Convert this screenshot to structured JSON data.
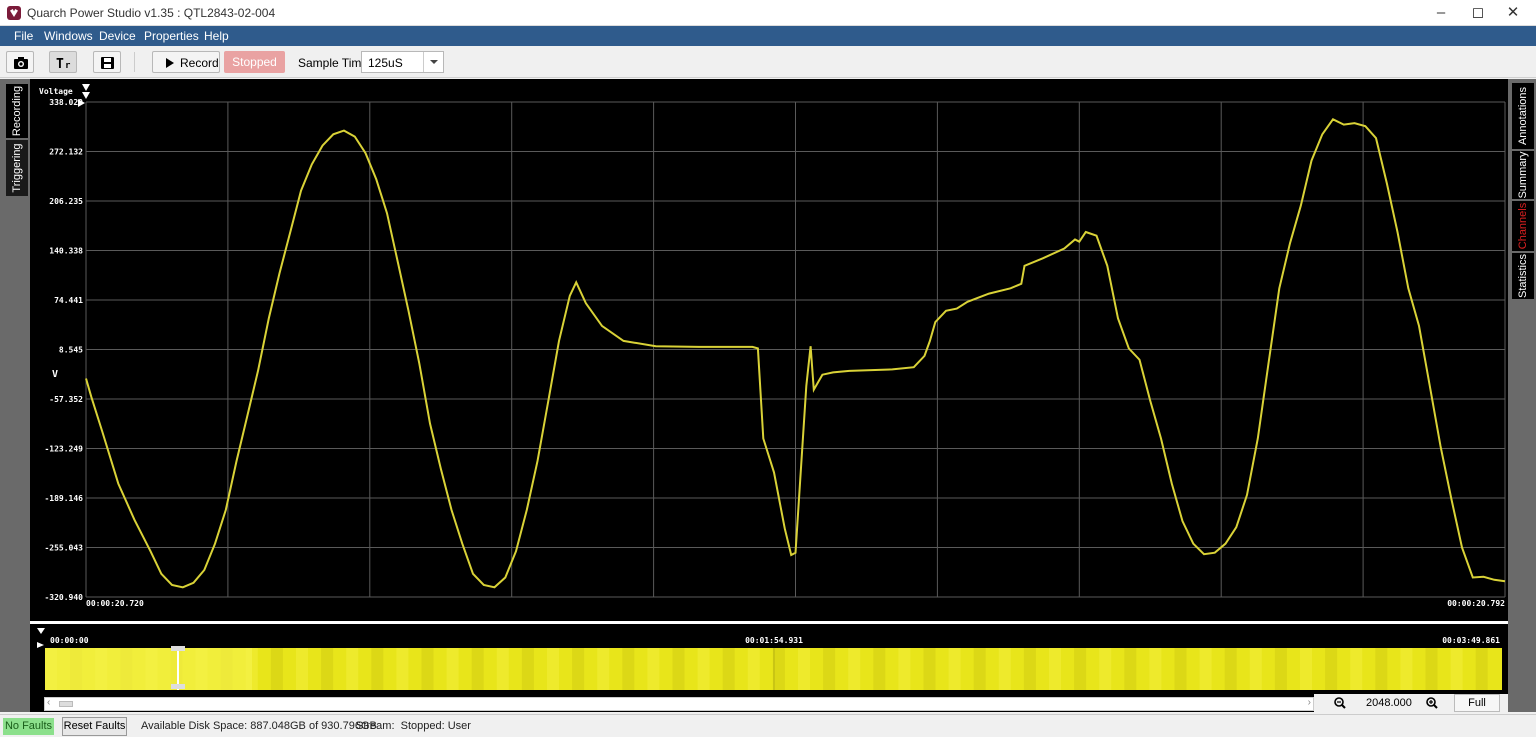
{
  "window": {
    "title": "Quarch Power Studio v1.35 : QTL2843-02-004"
  },
  "menu": {
    "file": "File",
    "windows": "Windows",
    "device": "Device",
    "properties": "Properties",
    "help": "Help"
  },
  "toolbar": {
    "record_label": "Record",
    "status_label": "Stopped",
    "sample_time_label": "Sample Time:",
    "sample_time_value": "125uS"
  },
  "left_tabs": {
    "recording": "Recording",
    "triggering": "Triggering"
  },
  "right_tabs": {
    "annotations": "Annotations",
    "summary": "Summary",
    "channels": "Channels",
    "statistics": "Statistics"
  },
  "chart_data": {
    "type": "line",
    "ylabel": "Voltage",
    "unit": "V",
    "ylim": [
      -320.94,
      338.029
    ],
    "yticks": [
      "338.029",
      "272.132",
      "206.235",
      "140.338",
      "74.441",
      "8.545",
      "-57.352",
      "-123.249",
      "-189.146",
      "-255.043",
      "-320.940"
    ],
    "x_start_label": "00:00:20.720",
    "x_end_label": "00:00:20.792",
    "grid": true,
    "color": "#d9d237",
    "series": [
      {
        "points": [
          [
            0.0,
            -30
          ],
          [
            0.5,
            -55
          ],
          [
            1.5,
            -100
          ],
          [
            3.0,
            -170
          ],
          [
            4.5,
            -218
          ],
          [
            6.0,
            -260
          ],
          [
            7.0,
            -290
          ],
          [
            8.0,
            -305
          ],
          [
            9.0,
            -308
          ],
          [
            10.0,
            -302
          ],
          [
            11.0,
            -285
          ],
          [
            12.0,
            -250
          ],
          [
            13.0,
            -205
          ],
          [
            14.0,
            -140
          ],
          [
            15.0,
            -80
          ],
          [
            16.0,
            -20
          ],
          [
            17.0,
            50
          ],
          [
            18.0,
            110
          ],
          [
            19.0,
            165
          ],
          [
            20.0,
            220
          ],
          [
            21.0,
            255
          ],
          [
            22.0,
            280
          ],
          [
            23.0,
            295
          ],
          [
            24.0,
            300
          ],
          [
            25.0,
            292
          ],
          [
            26.0,
            270
          ],
          [
            27.0,
            235
          ],
          [
            28.0,
            190
          ],
          [
            29.0,
            125
          ],
          [
            30.0,
            60
          ],
          [
            31.0,
            -10
          ],
          [
            32.0,
            -90
          ],
          [
            33.0,
            -150
          ],
          [
            34.0,
            -205
          ],
          [
            35.0,
            -250
          ],
          [
            36.0,
            -290
          ],
          [
            37.0,
            -305
          ],
          [
            38.0,
            -308
          ],
          [
            39.0,
            -295
          ],
          [
            40.0,
            -260
          ],
          [
            41.0,
            -205
          ],
          [
            42.0,
            -140
          ],
          [
            43.0,
            -60
          ],
          [
            44.0,
            20
          ],
          [
            45.0,
            80
          ],
          [
            45.6,
            98
          ],
          [
            46.5,
            70
          ],
          [
            48.0,
            40
          ],
          [
            50.0,
            20
          ],
          [
            53.0,
            13
          ],
          [
            57.0,
            12
          ],
          [
            62.0,
            12
          ],
          [
            62.5,
            10
          ],
          [
            63.0,
            -110
          ],
          [
            64.0,
            -155
          ],
          [
            65.0,
            -230
          ],
          [
            65.6,
            -265
          ],
          [
            66.0,
            -262
          ],
          [
            67.0,
            -40
          ],
          [
            67.4,
            13
          ],
          [
            67.7,
            -45
          ],
          [
            68.5,
            -25
          ],
          [
            69.5,
            -22
          ],
          [
            71.0,
            -20
          ],
          [
            75.0,
            -18
          ],
          [
            77.0,
            -15
          ],
          [
            78.0,
            0
          ],
          [
            78.5,
            20
          ],
          [
            79.0,
            45
          ],
          [
            80.0,
            60
          ],
          [
            81.0,
            63
          ],
          [
            82.0,
            72
          ],
          [
            84.0,
            83
          ],
          [
            86.0,
            90
          ],
          [
            87.0,
            96
          ],
          [
            87.3,
            120
          ],
          [
            89.0,
            130
          ],
          [
            91.0,
            143
          ],
          [
            92.0,
            155
          ],
          [
            92.4,
            152
          ],
          [
            93.0,
            165
          ],
          [
            94.0,
            160
          ],
          [
            95.0,
            120
          ],
          [
            96.0,
            50
          ],
          [
            97.0,
            10
          ],
          [
            98.0,
            -5
          ],
          [
            99.0,
            -60
          ],
          [
            100.0,
            -110
          ],
          [
            101.0,
            -170
          ],
          [
            102.0,
            -220
          ],
          [
            103.0,
            -250
          ],
          [
            104.0,
            -264
          ],
          [
            105.0,
            -262
          ],
          [
            106.0,
            -250
          ],
          [
            107.0,
            -228
          ],
          [
            108.0,
            -185
          ],
          [
            109.0,
            -110
          ],
          [
            110.0,
            -10
          ],
          [
            111.0,
            90
          ],
          [
            112.0,
            150
          ],
          [
            113.0,
            200
          ],
          [
            114.0,
            260
          ],
          [
            115.0,
            295
          ],
          [
            116.0,
            315
          ],
          [
            117.0,
            308
          ],
          [
            118.0,
            310
          ],
          [
            119.0,
            306
          ],
          [
            120.0,
            290
          ],
          [
            121.0,
            230
          ],
          [
            122.0,
            165
          ],
          [
            123.0,
            90
          ],
          [
            124.0,
            40
          ],
          [
            125.0,
            -40
          ],
          [
            126.0,
            -120
          ],
          [
            127.0,
            -190
          ],
          [
            128.0,
            -255
          ],
          [
            129.0,
            -295
          ],
          [
            130.0,
            -294
          ],
          [
            131.0,
            -298
          ],
          [
            132.0,
            -300
          ]
        ]
      }
    ]
  },
  "navigator": {
    "time_start": "00:00:00",
    "time_mid": "00:01:54.931",
    "time_end": "00:03:49.861",
    "color": "#e8e51a"
  },
  "zoom": {
    "value": "2048.000",
    "full_label": "Full"
  },
  "status": {
    "no_faults": "No Faults",
    "reset_faults": "Reset Faults",
    "disk_space": "Available Disk Space: 887.048GB of 930.796GB",
    "stream": "Stream:  Stopped: User"
  }
}
